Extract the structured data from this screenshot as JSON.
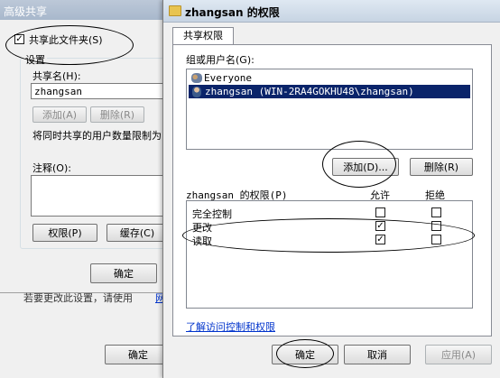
{
  "back": {
    "title": "高级共享",
    "share_checkbox_label": "共享此文件夹(S)",
    "share_checked": true,
    "settings_group_label": "设置",
    "share_name_label": "共享名(H):",
    "share_name_value": "zhangsan",
    "add_label": "添加(A)",
    "remove_label": "删除(R)",
    "limit_label": "将同时共享的用户数量限制为",
    "comment_label": "注释(O):",
    "permissions_label": "权限(P)",
    "cache_label": "缓存(C)",
    "ok_label": "确定",
    "bottom_text": "若要更改此设置，请使用",
    "bottom_link": "网",
    "outer_ok_label": "确定"
  },
  "dialog": {
    "title": "zhangsan 的权限",
    "tab_label": "共享权限",
    "group_label": "组或用户名(G):",
    "users": [
      {
        "name": "Everyone",
        "selected": false,
        "icon": "group-icon"
      },
      {
        "name": "zhangsan (WIN-2RA4GOKHU48\\zhangsan)",
        "selected": true,
        "icon": "user-icon"
      }
    ],
    "add_label": "添加(D)...",
    "remove_label": "删除(R)",
    "perm_header": "zhangsan 的权限(P)",
    "allow_header": "允许",
    "deny_header": "拒绝",
    "permissions": [
      {
        "name": "完全控制",
        "allow": false,
        "deny": false
      },
      {
        "name": "更改",
        "allow": true,
        "deny": false
      },
      {
        "name": "读取",
        "allow": true,
        "deny": false
      }
    ],
    "link_text": "了解访问控制和权限",
    "ok_label": "确定",
    "cancel_label": "取消",
    "apply_label": "应用(A)",
    "accent": "#0a246a"
  }
}
